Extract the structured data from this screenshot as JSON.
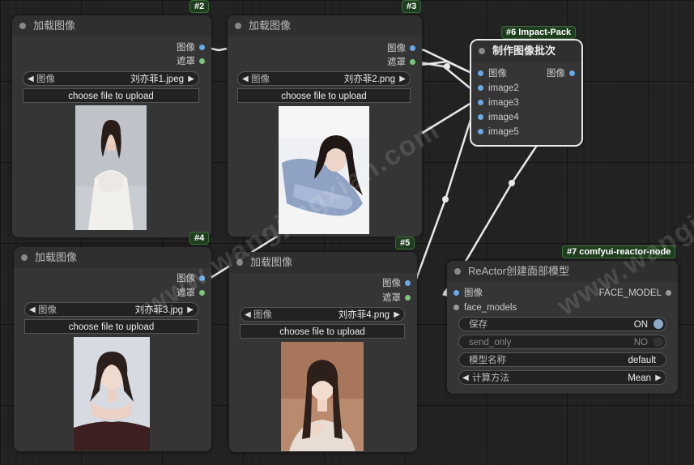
{
  "nodes": {
    "n2": {
      "badge": "#2",
      "title": "加载图像",
      "out1": "图像",
      "out2": "遮罩",
      "combo_label": "图像",
      "combo_value": "刘亦菲1.jpeg",
      "upload": "choose file to upload"
    },
    "n3": {
      "badge": "#3",
      "title": "加载图像",
      "out1": "图像",
      "out2": "遮罩",
      "combo_label": "图像",
      "combo_value": "刘亦菲2.png",
      "upload": "choose file to upload"
    },
    "n4": {
      "badge": "#4",
      "title": "加载图像",
      "out1": "图像",
      "out2": "遮罩",
      "combo_label": "图像",
      "combo_value": "刘亦菲3.jpg",
      "upload": "choose file to upload"
    },
    "n5": {
      "badge": "#5",
      "title": "加载图像",
      "out1": "图像",
      "out2": "遮罩",
      "combo_label": "图像",
      "combo_value": "刘亦菲4.png",
      "upload": "choose file to upload"
    },
    "n6": {
      "badge": "#6 Impact-Pack",
      "title": "制作图像批次",
      "inputs": [
        "图像",
        "image2",
        "image3",
        "image4",
        "image5"
      ],
      "out1": "图像"
    },
    "n7": {
      "badge": "#7 comfyui-reactor-node",
      "title": "ReActor创建面部模型",
      "in1": "图像",
      "in2": "face_models",
      "out1": "FACE_MODEL",
      "save_label": "保存",
      "save_value": "ON",
      "send_label": "send_only",
      "send_value": "NO",
      "name_label": "模型名称",
      "name_value": "default",
      "method_label": "计算方法",
      "method_value": "Mean"
    }
  },
  "watermark": "www.wangjingxian.com",
  "colors": {
    "link": "#e8e8e8",
    "port_image": "#6aa9e8",
    "port_mask": "#7bc47b",
    "badge_bg": "#1f3d1f"
  }
}
